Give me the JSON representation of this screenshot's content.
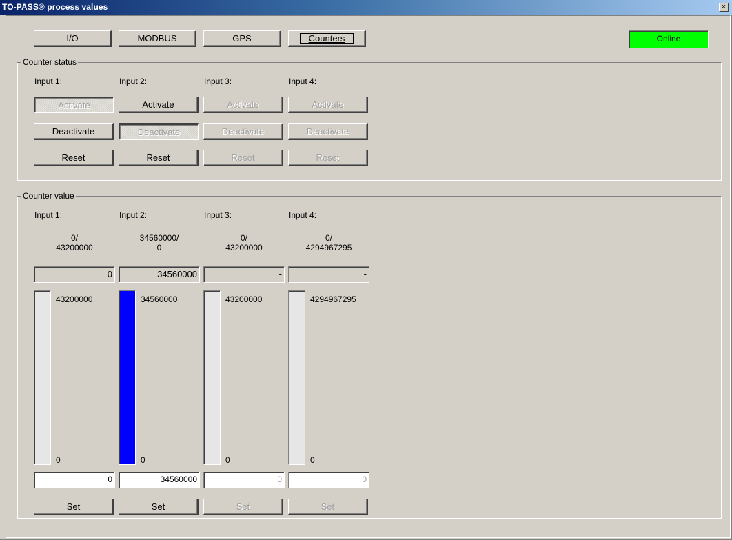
{
  "window": {
    "title": "TO-PASS® process values",
    "close_label": "×"
  },
  "tabs": [
    {
      "label": "I/O"
    },
    {
      "label": "MODBUS"
    },
    {
      "label": "GPS"
    },
    {
      "label": "Counters"
    }
  ],
  "status": {
    "text": "Online",
    "color": "#00ff00"
  },
  "counter_status": {
    "title": "Counter status",
    "inputs": [
      {
        "label": "Input 1:",
        "activate": "Activate",
        "deactivate": "Deactivate",
        "reset": "Reset"
      },
      {
        "label": "Input 2:",
        "activate": "Activate",
        "deactivate": "Deactivate",
        "reset": "Reset"
      },
      {
        "label": "Input 3:",
        "activate": "Activate",
        "deactivate": "Deactivate",
        "reset": "Reset"
      },
      {
        "label": "Input 4:",
        "activate": "Activate",
        "deactivate": "Deactivate",
        "reset": "Reset"
      }
    ]
  },
  "counter_value": {
    "title": "Counter value",
    "bar_color": "#0000ff",
    "inputs": [
      {
        "label": "Input 1:",
        "fraction_top": "0/",
        "fraction_bottom": "43200000",
        "current": "0",
        "max": "43200000",
        "min": "0",
        "fill_fraction": 0.0,
        "set_value": "0",
        "set_label": "Set"
      },
      {
        "label": "Input 2:",
        "fraction_top": "34560000/",
        "fraction_bottom": "0",
        "current": "34560000",
        "max": "34560000",
        "min": "0",
        "fill_fraction": 1.0,
        "set_value": "34560000",
        "set_label": "Set"
      },
      {
        "label": "Input 3:",
        "fraction_top": "0/",
        "fraction_bottom": "43200000",
        "current": "-",
        "max": "43200000",
        "min": "0",
        "fill_fraction": 0.0,
        "set_value": "0",
        "set_label": "Set"
      },
      {
        "label": "Input 4:",
        "fraction_top": "0/",
        "fraction_bottom": "4294967295",
        "current": "-",
        "max": "4294967295",
        "min": "0",
        "fill_fraction": 0.0,
        "set_value": "0",
        "set_label": "Set"
      }
    ]
  }
}
